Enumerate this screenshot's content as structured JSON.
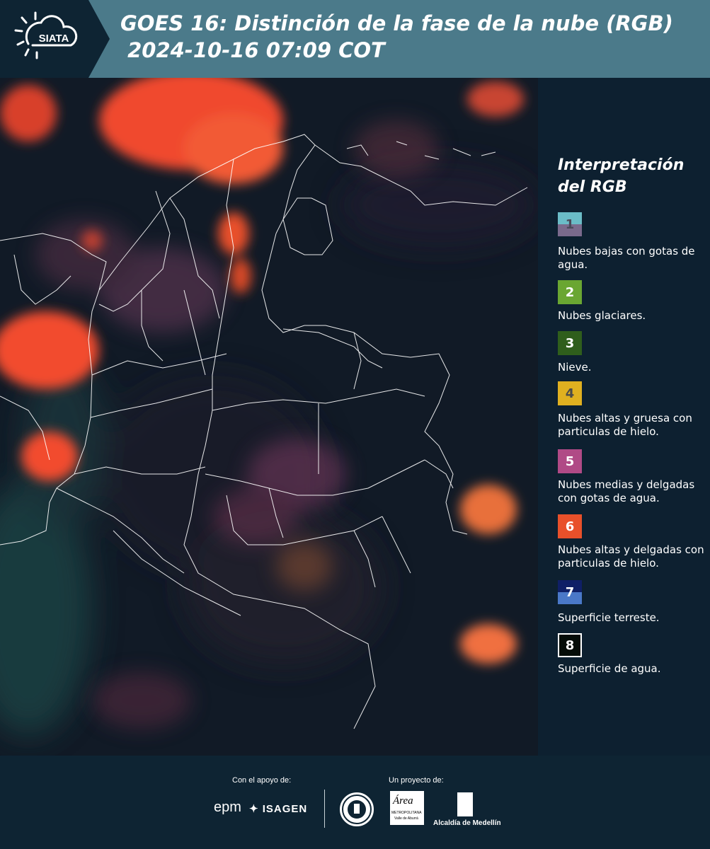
{
  "header": {
    "logo_text": "SIATA",
    "title_line1": "GOES 16: Distinción de la fase de la nube (RGB)",
    "title_line2": " 2024-10-16 07:09 COT"
  },
  "legend": {
    "title": "Interpretación del RGB",
    "items": [
      {
        "num": "1",
        "label": "Nubes bajas con gotas de agua.",
        "color_top": "#6bbcc7",
        "color_bottom": "#7a6a8c",
        "text_color": "#4a4a5a"
      },
      {
        "num": "2",
        "label": "Nubes glaciares.",
        "color_top": "#6aa632",
        "text_color": "#ffffff"
      },
      {
        "num": "3",
        "label": "Nieve.",
        "color_top": "#2f5e1c",
        "text_color": "#ffffff"
      },
      {
        "num": "4",
        "label": "Nubes altas y gruesa con particulas de hielo.",
        "color_top": "#e0b020",
        "text_color": "#4a4a4a"
      },
      {
        "num": "5",
        "label": "Nubes medias y delgadas con gotas de agua.",
        "color_top": "#b04a86",
        "text_color": "#ffffff"
      },
      {
        "num": "6",
        "label": "Nubes altas y delgadas con particulas de hielo.",
        "color_top": "#e8502a",
        "text_color": "#ffffff"
      },
      {
        "num": "7",
        "label": "Superficie terreste.",
        "color_top": "#0f1f66",
        "color_bottom": "#4a78c8",
        "text_color": "#ffffff"
      },
      {
        "num": "8",
        "label": "Superficie de agua.",
        "color_top": "#050c08",
        "text_color": "#ffffff"
      }
    ]
  },
  "footer": {
    "support_label": "Con el apoyo de:",
    "project_label": "Un proyecto de:",
    "sponsor1": "epm",
    "sponsor2": "ISAGEN",
    "partner_area": "Área",
    "partner_area_sub1": "METROPOLITANA",
    "partner_area_sub2": "Valle de Aburrá",
    "partner_alcaldia": "Alcaldía de Medellín"
  }
}
